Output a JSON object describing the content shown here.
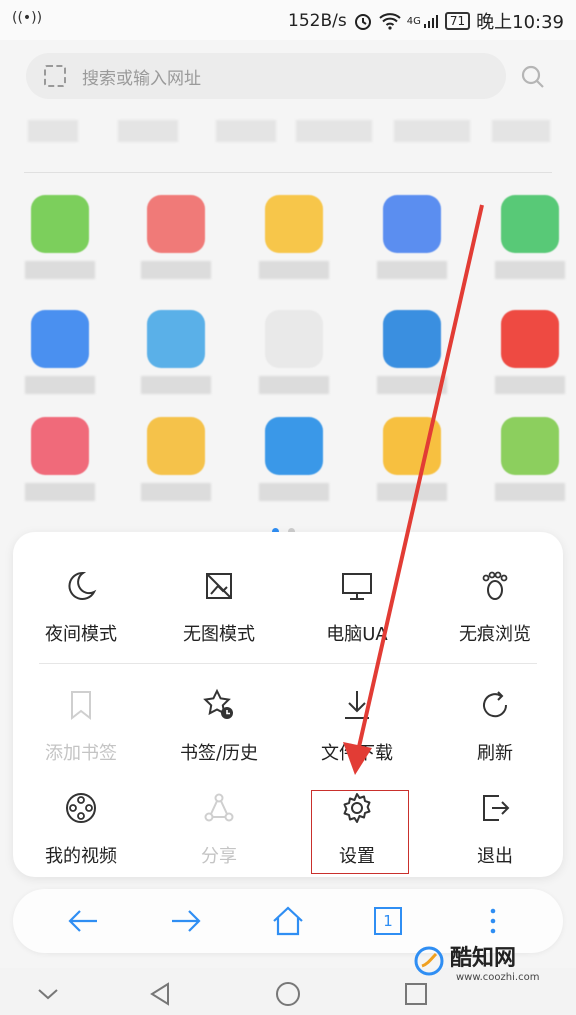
{
  "status_bar": {
    "signal": "((•))",
    "net_speed": "152B/s",
    "network": "4G",
    "battery": "71",
    "time": "晚上10:39"
  },
  "search": {
    "placeholder": "搜索或输入网址",
    "scan_icon": "scan-icon",
    "search_icon": "search-icon"
  },
  "page_dots": {
    "count": 2,
    "active": 1
  },
  "menu": {
    "rows": [
      [
        {
          "label": "夜间模式",
          "icon": "moon-icon",
          "enabled": true
        },
        {
          "label": "无图模式",
          "icon": "no-image-icon",
          "enabled": true
        },
        {
          "label": "电脑UA",
          "icon": "monitor-icon",
          "enabled": true
        },
        {
          "label": "无痕浏览",
          "icon": "footprint-icon",
          "enabled": true
        }
      ],
      [
        {
          "label": "添加书签",
          "icon": "bookmark-icon",
          "enabled": false
        },
        {
          "label": "书签/历史",
          "icon": "star-clock-icon",
          "enabled": true
        },
        {
          "label": "文件下载",
          "icon": "download-icon",
          "enabled": true
        },
        {
          "label": "刷新",
          "icon": "refresh-icon",
          "enabled": true
        }
      ],
      [
        {
          "label": "我的视频",
          "icon": "film-reel-icon",
          "enabled": true
        },
        {
          "label": "分享",
          "icon": "share-icon",
          "enabled": false
        },
        {
          "label": "设置",
          "icon": "gear-icon",
          "enabled": true
        },
        {
          "label": "退出",
          "icon": "exit-icon",
          "enabled": true
        }
      ]
    ]
  },
  "toolbar": {
    "back_icon": "back-arrow-icon",
    "forward_icon": "forward-arrow-icon",
    "home_icon": "home-icon",
    "tab_count": "1",
    "more_icon": "more-vertical-icon"
  },
  "nav_bar": {
    "icons": [
      "collapse-icon",
      "back-triangle-icon",
      "home-circle-icon",
      "recents-square-icon"
    ]
  },
  "watermark": {
    "title": "酷知网",
    "url": "www.coozhi.com"
  },
  "colors": {
    "accent": "#2f8ef3",
    "highlight": "#c9302c",
    "arrow": "#e23c35",
    "disabled": "#c4c4c4"
  },
  "app_icon_colors": [
    [
      "#7ccf5c",
      "#f07a78",
      "#f7c64a",
      "#5b8ef0",
      "#58c977"
    ],
    [
      "#4a90f0",
      "#5ab0e8",
      "#e9e9e9",
      "#3a8fe0",
      "#ee4a42"
    ],
    [
      "#f06a7a",
      "#f5c24a",
      "#3a98e8",
      "#f7c040",
      "#8ccf5e"
    ]
  ]
}
